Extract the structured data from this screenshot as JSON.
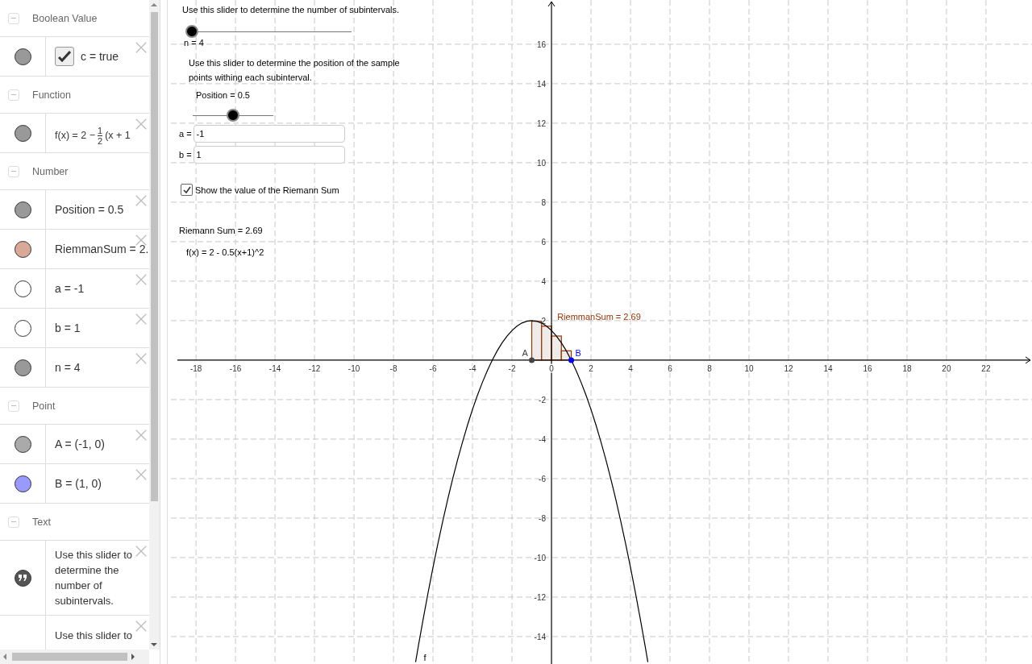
{
  "algebra": {
    "groups": [
      {
        "title": "Boolean Value",
        "expanded": true,
        "items": [
          {
            "kind": "boolean",
            "marble": {
              "visible": true,
              "color": "#999999"
            },
            "checked": true,
            "text": "c = true"
          }
        ]
      },
      {
        "title": "Function",
        "expanded": true,
        "items": [
          {
            "kind": "fraction",
            "marble": {
              "visible": true,
              "color": "#999999"
            },
            "text": "f(x) = 2 −",
            "numerator": "1",
            "denominator": "2",
            "rest": "(x + 1"
          }
        ]
      },
      {
        "title": "Number",
        "expanded": true,
        "items": [
          {
            "kind": "plain",
            "marble": {
              "visible": true,
              "color": "#999999"
            },
            "text": "Position = 0.5"
          },
          {
            "kind": "plain",
            "marble": {
              "visible": true,
              "color": "#d9a896"
            },
            "text": "RiemmanSum = 2."
          },
          {
            "kind": "plain",
            "marble": {
              "visible": false,
              "color": "#ffffff"
            },
            "text": "a = -1"
          },
          {
            "kind": "plain",
            "marble": {
              "visible": false,
              "color": "#ffffff"
            },
            "text": "b = 1"
          },
          {
            "kind": "plain",
            "marble": {
              "visible": true,
              "color": "#999999"
            },
            "text": "n = 4"
          }
        ]
      },
      {
        "title": "Point",
        "expanded": true,
        "items": [
          {
            "kind": "plain",
            "marble": {
              "visible": true,
              "color": "#aaaaaa"
            },
            "text": "A = (-1, 0)"
          },
          {
            "kind": "plain",
            "marble": {
              "visible": true,
              "color": "#9999ff"
            },
            "text": "B = (1, 0)"
          }
        ]
      },
      {
        "title": "Text",
        "expanded": true,
        "items": [
          {
            "kind": "text",
            "marble": {
              "visible": true,
              "color": "#555555"
            },
            "text": "Use this slider to determine the number of subintervals."
          },
          {
            "kind": "text",
            "text": "Use this slider to"
          }
        ]
      }
    ]
  },
  "graphics": {
    "controls": [
      {
        "kind": "text",
        "text": "Use this slider to determine the number of subintervals."
      },
      {
        "kind": "slider",
        "label": "n = 4",
        "level": 0
      },
      {
        "kind": "text",
        "text": "Use this slider to determine the position of the sample points withing each subinterval."
      },
      {
        "kind": "slider",
        "label": "Position = 0.5",
        "level": 0.5
      },
      {
        "kind": "input",
        "label": "a =",
        "value": "-1"
      },
      {
        "kind": "input",
        "label": "b =",
        "value": "1"
      },
      {
        "kind": "checkbox",
        "label": "Show the value of the Riemann Sum",
        "checked": true
      },
      {
        "kind": "text",
        "text": "Riemann Sum = 2.69"
      },
      {
        "kind": "text",
        "text": "f(x) = 2 - 0.5(x+1)^2"
      }
    ],
    "points": [
      {
        "label": "A",
        "color": "#444444"
      },
      {
        "label": "B",
        "color": "#0000ff"
      }
    ],
    "chart_data": {
      "type": "line",
      "x": [
        -6.88,
        -6.75,
        -6.5,
        -6.25,
        -6,
        -5.75,
        -5.5,
        -5.25,
        -5,
        -4.75,
        -4.5,
        -4.25,
        -4,
        -3.75,
        -3.5,
        -3.25,
        -3,
        -2.75,
        -2.5,
        -2.25,
        -2,
        -1.75,
        -1.5,
        -1.25,
        -1,
        -0.75,
        -0.5,
        -0.25,
        0,
        0.25,
        0.5,
        0.75,
        1,
        1.25,
        1.5,
        1.75,
        2,
        2.25,
        2.5,
        2.75,
        3,
        3.25,
        3.5,
        3.75,
        4,
        4.25,
        4.5,
        4.75,
        4.88
      ],
      "series": [
        {
          "name": "f",
          "color": "#000000",
          "values": [
            -15.29,
            -14.53,
            -13.13,
            -11.78,
            -10.5,
            -9.28,
            -8.13,
            -7.03,
            -6,
            -5.03,
            -4.13,
            -3.28,
            -2.5,
            -1.78,
            -1.13,
            -0.53,
            0,
            0.47,
            0.88,
            1.22,
            1.5,
            1.72,
            1.88,
            1.97,
            2,
            1.97,
            1.88,
            1.72,
            1.5,
            1.22,
            0.88,
            0.47,
            0,
            -0.53,
            -1.13,
            -1.78,
            -2.5,
            -3.28,
            -4.13,
            -5.03,
            -6,
            -7.03,
            -8.13,
            -9.28,
            -10.5,
            -11.78,
            -13.13,
            -14.53,
            -15.29
          ]
        }
      ],
      "xlim": [
        -19.27,
        24.33
      ],
      "ylim": [
        -15.39,
        18.24
      ],
      "xticks": [
        -18,
        -16,
        -14,
        -12,
        -10,
        -8,
        -6,
        -4,
        -2,
        0,
        2,
        4,
        6,
        8,
        10,
        12,
        14,
        16,
        18,
        20,
        22
      ],
      "yticks": [
        -14,
        -12,
        -10,
        -8,
        -6,
        -4,
        -2,
        2,
        4,
        6,
        8,
        10,
        12,
        14,
        16
      ],
      "grid": true,
      "annotations": [
        "RiemmanSum = 2.69"
      ]
    }
  }
}
